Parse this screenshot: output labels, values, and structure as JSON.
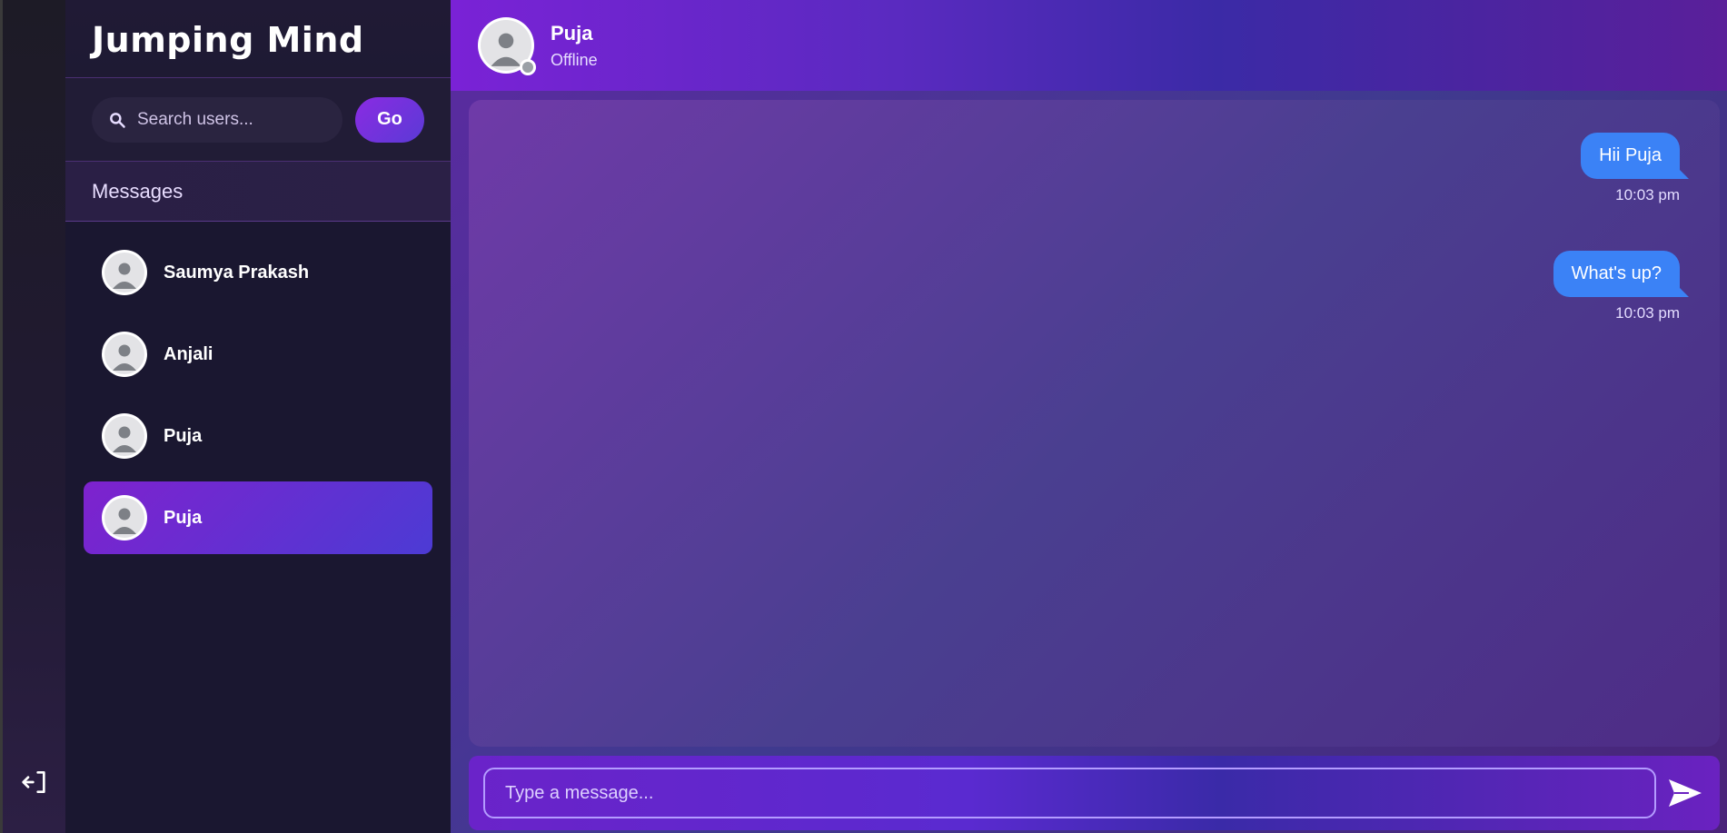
{
  "app": {
    "title": "Jumping Mind"
  },
  "search": {
    "placeholder": "Search users...",
    "button_label": "Go"
  },
  "sidebar": {
    "section_title": "Messages",
    "users": [
      {
        "name": "Saumya Prakash",
        "active": false
      },
      {
        "name": "Anjali",
        "active": false
      },
      {
        "name": "Puja",
        "active": false
      },
      {
        "name": "Puja",
        "active": true
      }
    ]
  },
  "chat": {
    "contact_name": "Puja",
    "contact_status": "Offline",
    "messages": [
      {
        "text": "Hii Puja",
        "time": "10:03 pm",
        "sender": "me"
      },
      {
        "text": "What's up?",
        "time": "10:03 pm",
        "sender": "me"
      }
    ],
    "composer_placeholder": "Type a message..."
  },
  "icons": {
    "logout": "logout-icon",
    "search": "search-icon",
    "send": "send-icon",
    "avatar": "user-avatar-icon"
  },
  "colors": {
    "accent": "#8a2be2",
    "bubble": "#3b82f6",
    "status_offline": "#9aa0a6"
  }
}
